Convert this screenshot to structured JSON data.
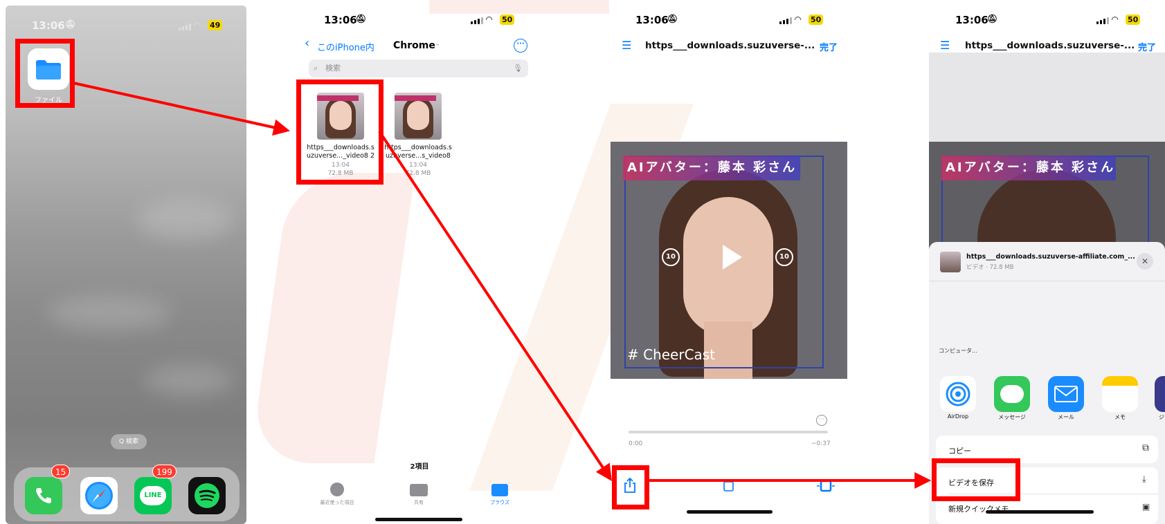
{
  "panel_home": {
    "status_time": "13:06",
    "battery": "49",
    "files_app_label": "ファイル",
    "search_pill": "Q 検索",
    "dock_apps": [
      {
        "name": "phone",
        "badge": "15"
      },
      {
        "name": "safari",
        "badge": ""
      },
      {
        "name": "line",
        "badge": "199",
        "label": "LINE"
      },
      {
        "name": "spotify",
        "badge": ""
      }
    ]
  },
  "panel_files": {
    "status_time": "13:06",
    "battery": "50",
    "back_label": "このiPhone内",
    "folder_title": "Chrome",
    "search_placeholder": "検索",
    "files": [
      {
        "name_line1": "https___downloads.s",
        "name_line2": "uzuverse..._video8 2",
        "time": "13:04",
        "size": "72.8 MB"
      },
      {
        "name_line1": "https___downloads.s",
        "name_line2": "uzuverse...s_video8",
        "time": "13:04",
        "size": "72.8 MB"
      }
    ],
    "item_count": "2項目",
    "tabs": [
      {
        "label": "最近使った項目",
        "active": false
      },
      {
        "label": "共有",
        "active": false
      },
      {
        "label": "ブラウズ",
        "active": true
      }
    ]
  },
  "panel_player": {
    "status_time": "13:06",
    "battery": "50",
    "title": "https___downloads.suzuverse-...",
    "done_label": "完了",
    "video_banner": "AIアバター：藤本 彩さん",
    "video_hashtag": "# CheerCast",
    "skip_back": "10",
    "skip_forward": "10",
    "time_elapsed": "0:00",
    "time_remaining": "−0:37"
  },
  "panel_share": {
    "status_time": "13:06",
    "battery": "50",
    "title": "https___downloads.suzuverse-...",
    "done_label": "完了",
    "video_banner": "AIアバター：藤本 彩さん",
    "file_title": "https___downloads.suzuverse-affiliate.com_...",
    "file_subtitle": "ビデオ · 72.8 MB",
    "section_label": "コンピュータ...",
    "share_apps": [
      {
        "label": "AirDrop"
      },
      {
        "label": "メッセージ"
      },
      {
        "label": "メール"
      },
      {
        "label": "メモ"
      },
      {
        "label": "ジ"
      }
    ],
    "actions": [
      {
        "label": "コピー"
      },
      {
        "label": "ビデオを保存"
      },
      {
        "label": "新規クイックメモ"
      }
    ]
  },
  "colors": {
    "annotation_red": "#ff0000",
    "ios_blue": "#007aff",
    "battery_yellow": "#f5d90a"
  }
}
